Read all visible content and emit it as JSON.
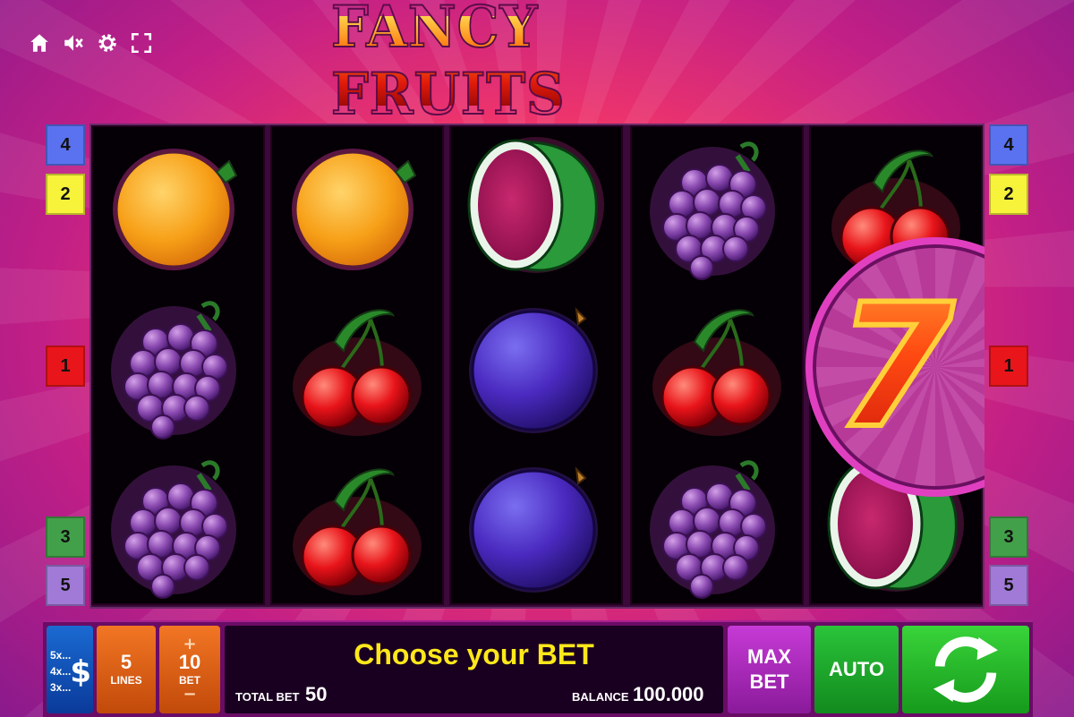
{
  "title": "FANCY FRUITS",
  "top_icons": [
    "home-icon",
    "speaker-mute-icon",
    "gear-icon",
    "fullscreen-icon"
  ],
  "line_badges": {
    "left": [
      {
        "label": "4",
        "color": "#5a72f0"
      },
      {
        "label": "2",
        "color": "#f7f23a"
      },
      {
        "label": "1",
        "color": "#e8161a"
      },
      {
        "label": "3",
        "color": "#43a04a"
      },
      {
        "label": "5",
        "color": "#a07ad6"
      }
    ],
    "right": [
      {
        "label": "4",
        "color": "#5a72f0"
      },
      {
        "label": "2",
        "color": "#f7f23a"
      },
      {
        "label": "1",
        "color": "#e8161a"
      },
      {
        "label": "3",
        "color": "#43a04a"
      },
      {
        "label": "5",
        "color": "#a07ad6"
      }
    ]
  },
  "reels": [
    [
      "orange",
      "grapes",
      "grapes"
    ],
    [
      "orange",
      "cherries",
      "cherries"
    ],
    [
      "watermelon",
      "plum",
      "plum"
    ],
    [
      "grapes",
      "cherries",
      "grapes"
    ],
    [
      "cherries",
      "seven",
      "watermelon"
    ]
  ],
  "big_symbol": "7",
  "controls": {
    "paytable_lines": [
      "5x...",
      "4x...",
      "3x..."
    ],
    "paytable_icon": "$",
    "lines_value": "5",
    "lines_label": "LINES",
    "bet_plus": "+",
    "bet_value": "10",
    "bet_label": "BET",
    "bet_minus": "−",
    "message": "Choose your BET",
    "total_bet_label": "TOTAL BET",
    "total_bet_value": "50",
    "balance_label": "BALANCE",
    "balance_value": "100.000",
    "max_bet_line1": "MAX",
    "max_bet_line2": "BET",
    "auto_label": "AUTO",
    "spin_icon": "spin-arrows-icon"
  }
}
